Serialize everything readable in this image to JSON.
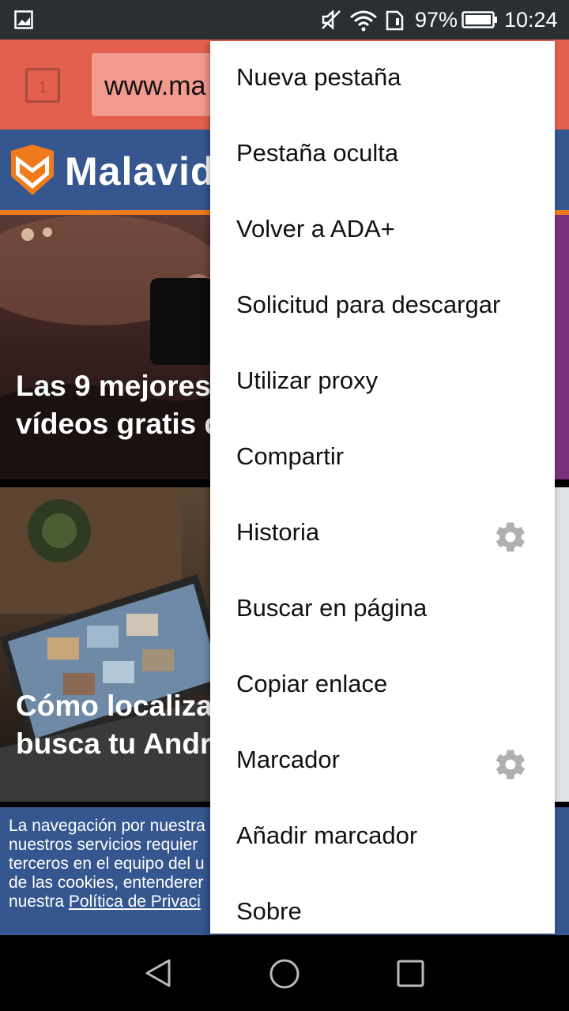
{
  "status_bar": {
    "battery": "97%",
    "time": "10:24",
    "icons": [
      "image-icon",
      "mute-icon",
      "wifi-icon",
      "sim-icon",
      "battery-icon"
    ]
  },
  "browser": {
    "tab_count": "1",
    "url": "www.ma"
  },
  "site": {
    "logo_text": "Malavida",
    "accent_color": "#f07b1d",
    "header_color": "#35568f"
  },
  "articles": [
    {
      "title_line1": "Las 9 mejores",
      "title_line2": "vídeos gratis d"
    },
    {
      "title_line1": "Cómo localiza",
      "title_line2": "busca tu Andr"
    }
  ],
  "cookie_notice": {
    "line1": "La navegación por nuestra",
    "line2": "nuestros servicios requier",
    "line3": "terceros en el equipo del u",
    "line4": "de las cookies, entenderer",
    "line5_prefix": "nuestra ",
    "link": "Política de Privaci"
  },
  "menu": {
    "items": [
      {
        "label": "Nueva pestaña"
      },
      {
        "label": "Pestaña oculta"
      },
      {
        "label": "Volver a ADA+"
      },
      {
        "label": "Solicitud para descargar"
      },
      {
        "label": "Utilizar proxy"
      },
      {
        "label": "Compartir"
      },
      {
        "label": "Historia",
        "settings_icon": "gear-icon"
      },
      {
        "label": "Buscar en página"
      },
      {
        "label": "Copiar enlace"
      },
      {
        "label": "Marcador",
        "settings_icon": "gear-icon"
      },
      {
        "label": "Añadir marcador"
      },
      {
        "label": "Sobre"
      }
    ]
  },
  "nav_bar": {
    "icons": [
      "back-icon",
      "home-icon",
      "recents-icon"
    ]
  }
}
